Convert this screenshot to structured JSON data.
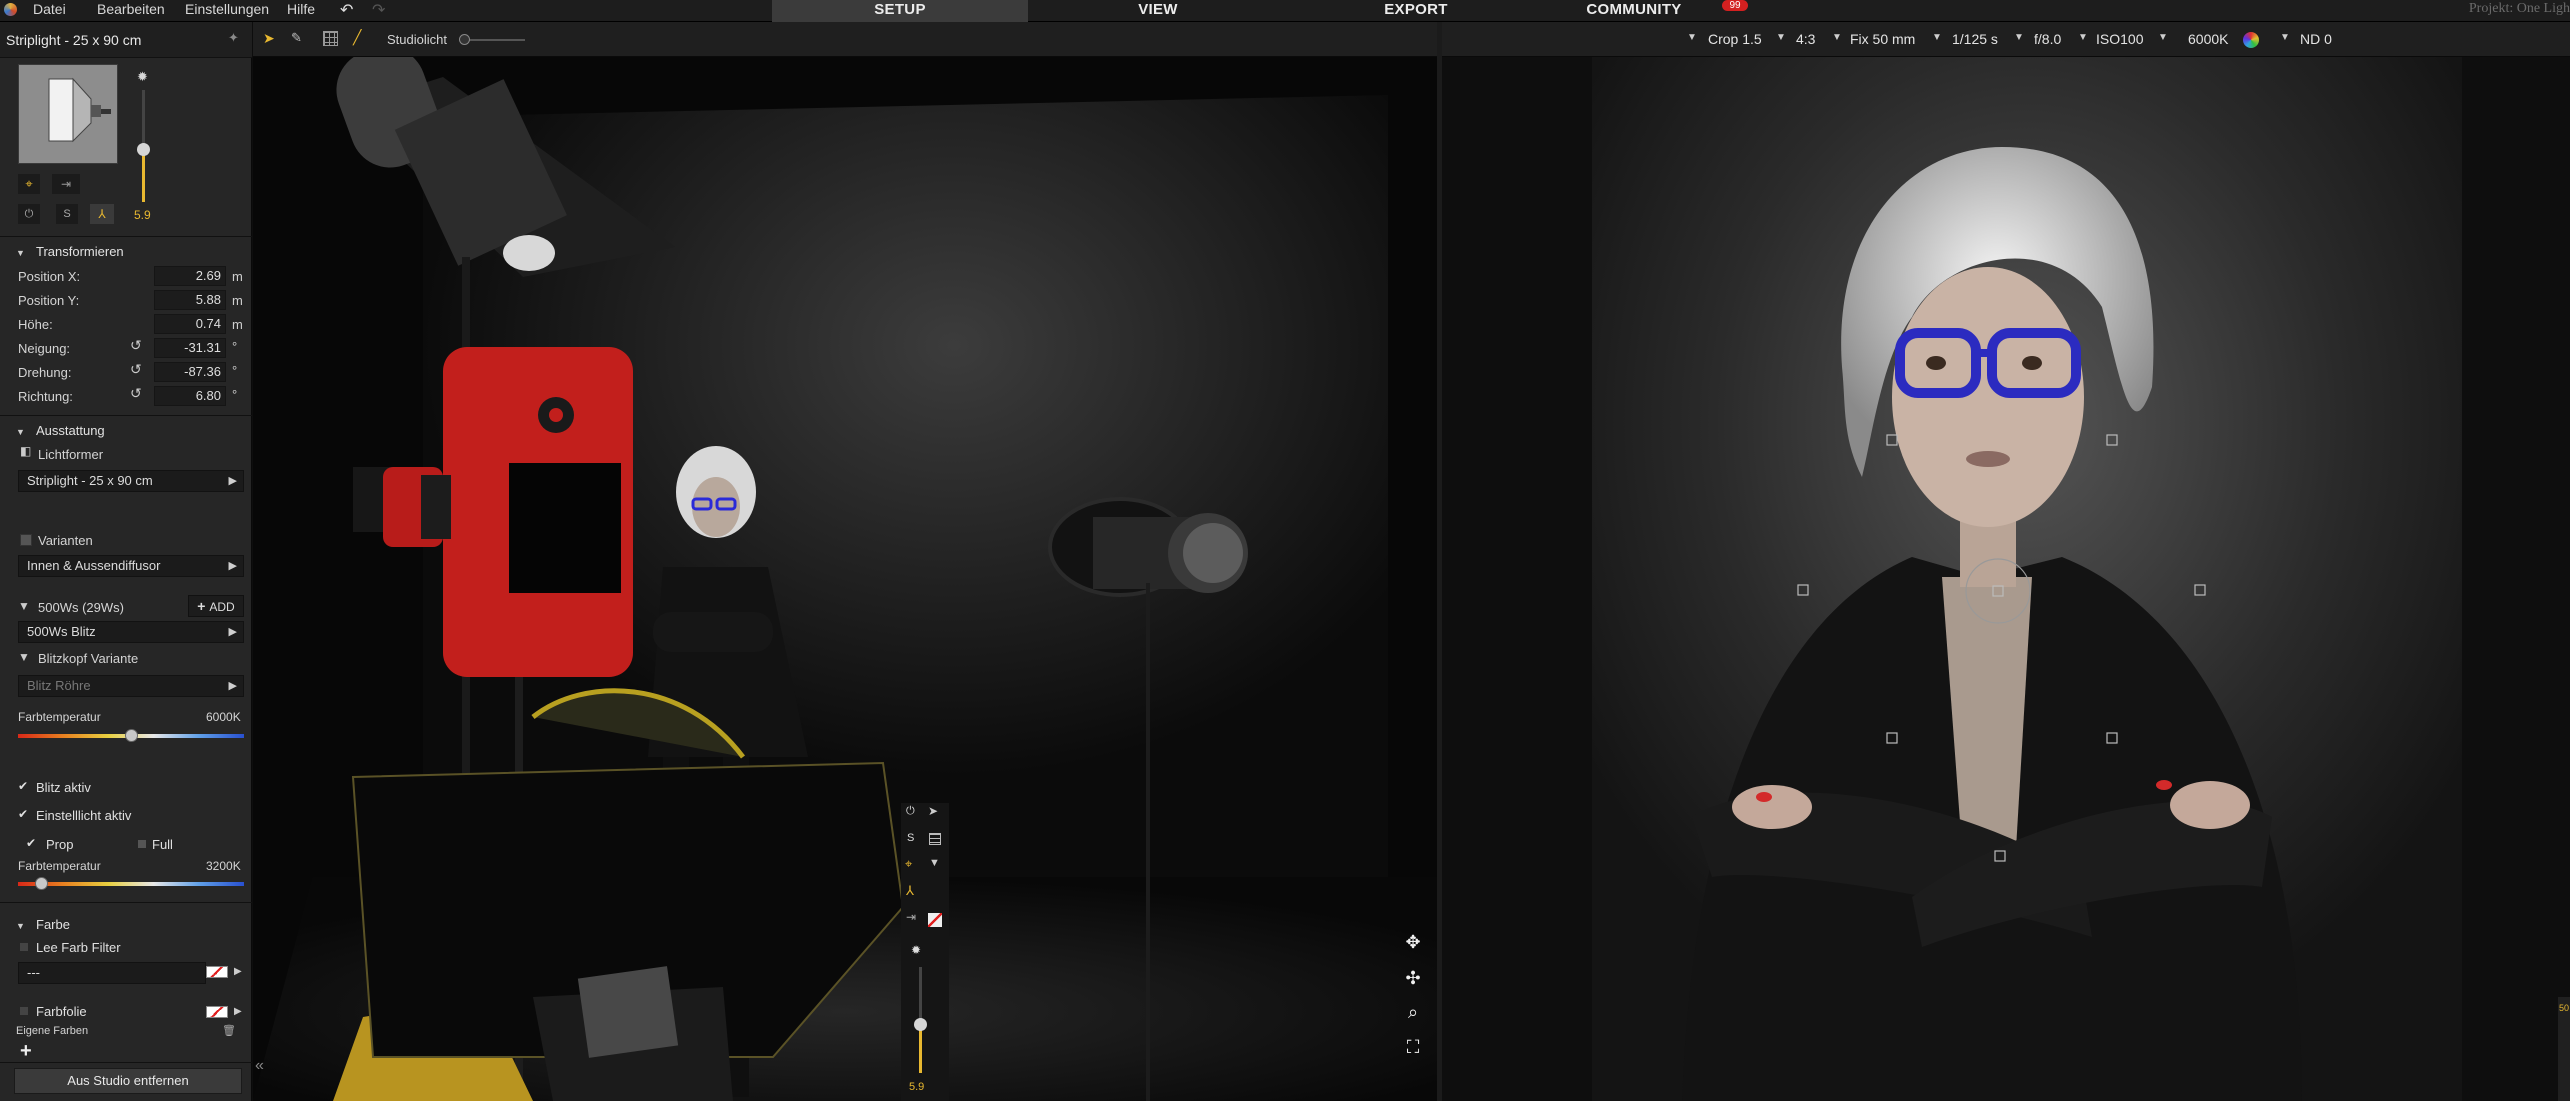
{
  "menubar": {
    "items": [
      "Datei",
      "Bearbeiten",
      "Einstellungen",
      "Hilfe"
    ],
    "tabs": [
      "SETUP",
      "VIEW",
      "EXPORT",
      "COMMUNITY"
    ],
    "community_badge": "99",
    "project": "Projekt: One Ligh"
  },
  "panel": {
    "title": "Striplight - 25 x 90 cm",
    "power_value": "5.9",
    "transform": {
      "header": "Transformieren",
      "fields": [
        {
          "label": "Position X:",
          "value": "2.69",
          "unit": "m"
        },
        {
          "label": "Position Y:",
          "value": "5.88",
          "unit": "m"
        },
        {
          "label": "Höhe:",
          "value": "0.74",
          "unit": "m"
        },
        {
          "label": "Neigung:",
          "value": "-31.31",
          "unit": "°"
        },
        {
          "label": "Drehung:",
          "value": "-87.36",
          "unit": "°"
        },
        {
          "label": "Richtung:",
          "value": "6.80",
          "unit": "°"
        }
      ]
    },
    "equipment": {
      "header": "Ausstattung",
      "modifier_label": "Lichtformer",
      "modifier_value": "Striplight - 25 x 90 cm",
      "variants_label": "Varianten",
      "variants_value": "Innen & Aussendiffusor",
      "flash_label": "500Ws (29Ws)",
      "add_label": "ADD",
      "flash_value": "500Ws Blitz",
      "head_label": "Blitzkopf Variante",
      "head_value": "Blitz Röhre"
    },
    "colortemp1": {
      "label": "Farbtemperatur",
      "value": "6000K",
      "fraction": 0.5
    },
    "flash_active": "Blitz aktiv",
    "modeling_active": "Einstelllicht aktiv",
    "prop": "Prop",
    "full": "Full",
    "colortemp2": {
      "label": "Farbtemperatur",
      "value": "3200K",
      "fraction": 0.1
    },
    "color": {
      "header": "Farbe",
      "filter_label": "Lee Farb Filter",
      "filter_value": "---",
      "foil_label": "Farbfolie",
      "own_colors": "Eigene Farben",
      "add_symbol": "+"
    },
    "remove_button": "Aus Studio entfernen"
  },
  "midtoolbar": {
    "studio_light": "Studiolicht"
  },
  "camera": {
    "crop": "Crop 1.5",
    "ratio": "4:3",
    "lens": "Fix 50 mm",
    "shutter": "1/125 s",
    "aperture": "f/8.0",
    "iso": "ISO100",
    "wb": "6000K",
    "nd": "ND 0"
  },
  "viewport": {
    "power_value": "5.9"
  },
  "icons": {
    "undo": "undo-icon",
    "redo": "redo-icon",
    "pin": "pin-icon",
    "move": "move-icon",
    "zoom": "zoom-icon",
    "fit": "fit-icon"
  }
}
